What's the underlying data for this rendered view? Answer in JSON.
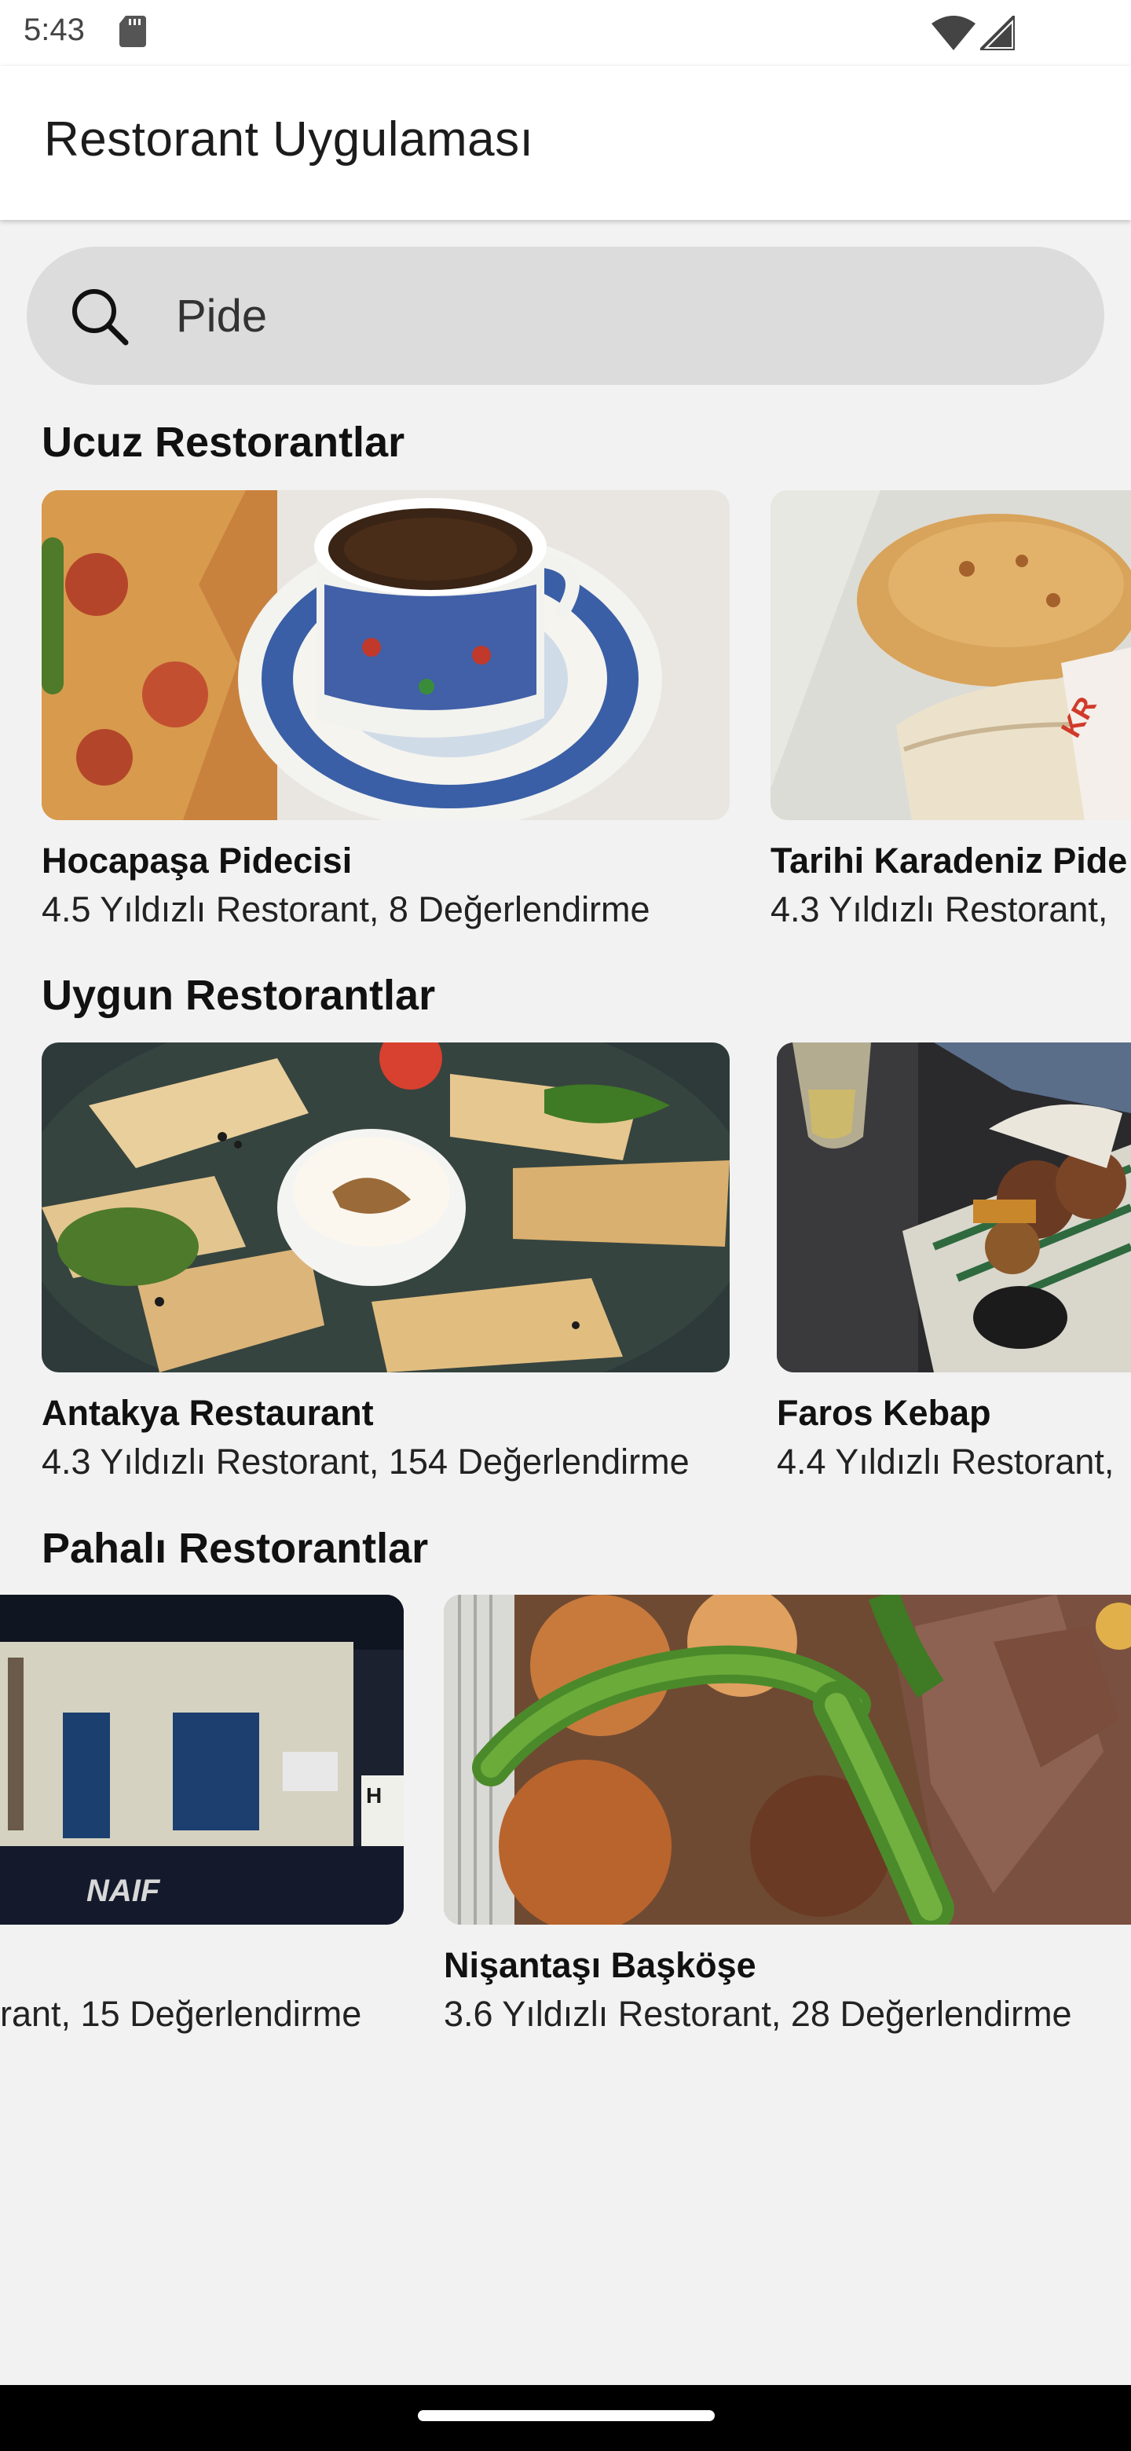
{
  "status_bar": {
    "time": "5:43",
    "icons": [
      "sd-card-icon",
      "wifi-icon",
      "signal-icon"
    ]
  },
  "app_bar": {
    "title": "Restorant Uygulaması"
  },
  "search": {
    "value": "Pide",
    "icon": "search-icon"
  },
  "sections": [
    {
      "title": "Ucuz Restorantlar",
      "cards": [
        {
          "name": "Hocapaşa Pidecisi",
          "meta": "4.5 Yıldızlı Restorant, 8 Değerlendirme"
        },
        {
          "name": "Tarihi Karadeniz Pide",
          "meta": "4.3 Yıldızlı Restorant,"
        }
      ]
    },
    {
      "title": "Uygun Restorantlar",
      "cards": [
        {
          "name": "Antakya Restaurant",
          "meta": "4.3 Yıldızlı Restorant, 154 Değerlendirme"
        },
        {
          "name": "Faros Kebap",
          "meta": "4.4 Yıldızlı Restorant,"
        }
      ]
    },
    {
      "title": "Pahalı Restorantlar",
      "cards": [
        {
          "name": "",
          "meta": "rant, 15 Değerlendirme",
          "sign_text": "NAIF"
        },
        {
          "name": "Nişantaşı Başköşe",
          "meta": "3.6 Yıldızlı Restorant, 28 Değerlendirme"
        }
      ]
    }
  ]
}
